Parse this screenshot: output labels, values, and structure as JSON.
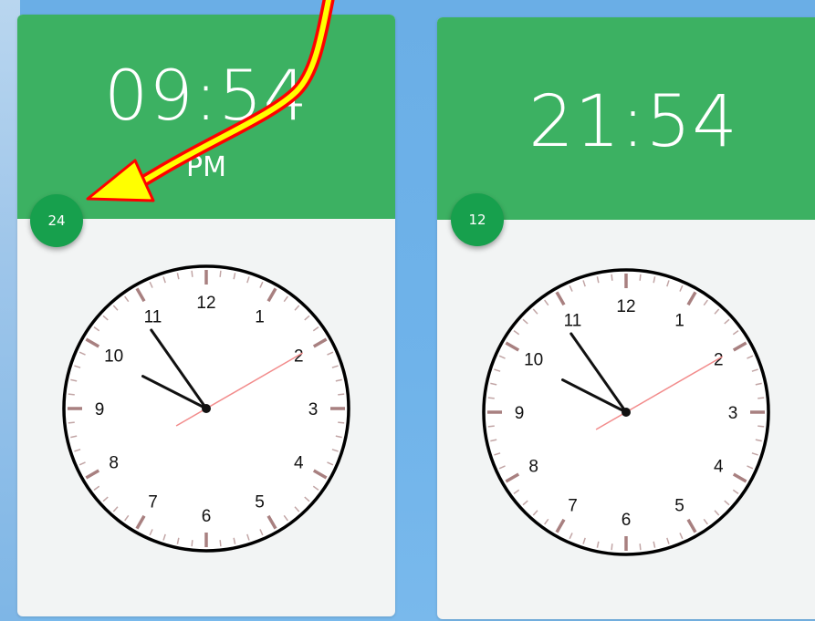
{
  "clocks": [
    {
      "time": "09:54",
      "ampm": "PM",
      "mode_button": "24",
      "hours": 9,
      "minutes": 54,
      "seconds": 10
    },
    {
      "time": "21:54",
      "mode_button": "12",
      "hours": 9,
      "minutes": 54,
      "seconds": 10
    }
  ],
  "dial_numbers": [
    "12",
    "1",
    "2",
    "3",
    "4",
    "5",
    "6",
    "7",
    "8",
    "9",
    "10",
    "11"
  ],
  "colors": {
    "header_green": "#3cb162",
    "button_green": "#17a04d",
    "card_bg": "#f2f4f4",
    "second_hand": "#f28b8b",
    "tick_color": "#9a6b6b",
    "annotation_arrow_fill": "#ffff00",
    "annotation_arrow_stroke": "#ff0000"
  }
}
